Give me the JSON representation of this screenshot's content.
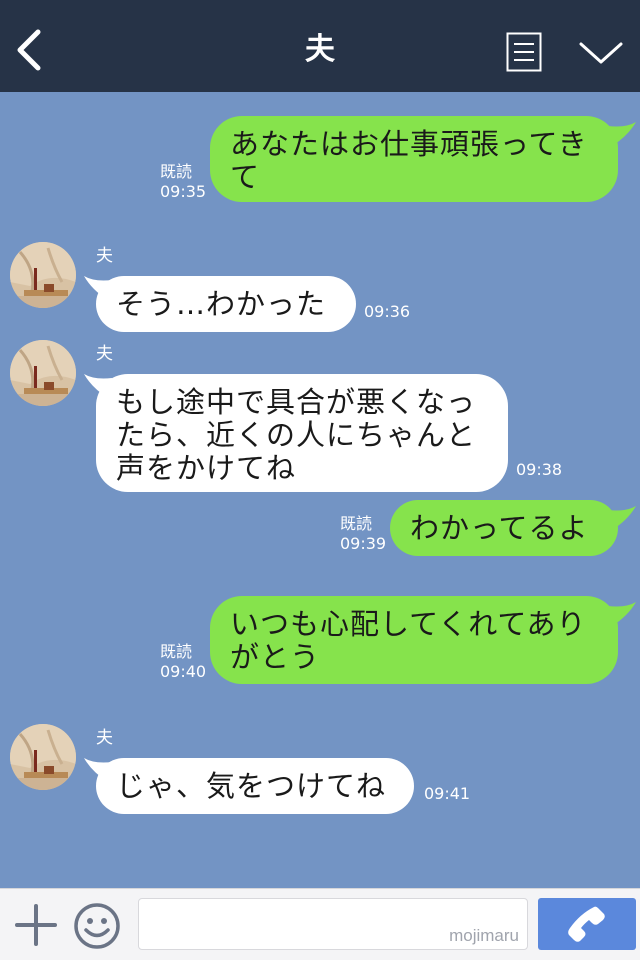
{
  "header": {
    "title": "夫",
    "back_icon": "chevron-left-icon",
    "menu_icon": "list-menu-icon",
    "collapse_icon": "chevron-down-icon"
  },
  "messages": [
    {
      "type": "sent",
      "lines": [
        "あなたはお仕事頑張ってき",
        "て"
      ],
      "read": "既読",
      "time": "09:35"
    },
    {
      "type": "received",
      "sender": "夫",
      "lines": [
        "そう…わかった"
      ],
      "time": "09:36"
    },
    {
      "type": "received",
      "sender": "夫",
      "lines": [
        "もし途中で具合が悪くなっ",
        "たら、近くの人にちゃんと",
        "声をかけてね"
      ],
      "time": "09:38"
    },
    {
      "type": "sent",
      "lines": [
        "わかってるよ"
      ],
      "read": "既読",
      "time": "09:39"
    },
    {
      "type": "sent",
      "lines": [
        "いつも心配してくれてあり",
        "がとう"
      ],
      "read": "既読",
      "time": "09:40"
    },
    {
      "type": "received",
      "sender": "夫",
      "lines": [
        "じゃ、気をつけてね"
      ],
      "time": "09:41"
    }
  ],
  "inputbar": {
    "plus_icon": "plus-icon",
    "emoji_icon": "smiley-icon",
    "watermark": "mojimaru",
    "call_icon": "phone-icon"
  },
  "colors": {
    "header_bg": "#263347",
    "chat_bg": "#7394c4",
    "sent_bubble": "#86e34c",
    "received_bubble": "#ffffff",
    "call_button": "#5b88dc"
  }
}
